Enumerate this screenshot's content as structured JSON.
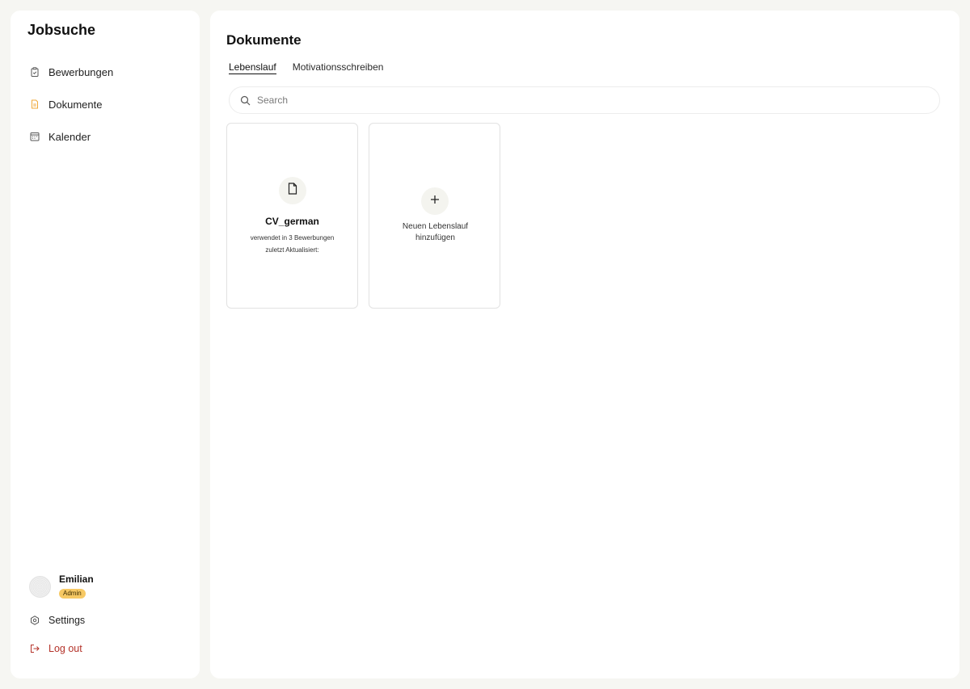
{
  "app": {
    "title": "Jobsuche"
  },
  "sidebar": {
    "items": [
      {
        "label": "Bewerbungen",
        "icon": "clipboard-icon",
        "active": false
      },
      {
        "label": "Dokumente",
        "icon": "document-icon",
        "active": true
      },
      {
        "label": "Kalender",
        "icon": "calendar-icon",
        "active": false
      }
    ],
    "user": {
      "name": "Emilian",
      "role": "Admin"
    },
    "settings_label": "Settings",
    "logout_label": "Log out"
  },
  "main": {
    "title": "Dokumente",
    "tabs": [
      {
        "label": "Lebenslauf",
        "active": true
      },
      {
        "label": "Motivationsschreiben",
        "active": false
      }
    ],
    "search": {
      "placeholder": "Search",
      "value": ""
    },
    "documents": [
      {
        "name": "CV_german",
        "usage": "verwendet in 3 Bewerbungen",
        "updated": "zuletzt Aktualisiert:"
      }
    ],
    "add_card": {
      "label": "Neuen Lebenslauf hinzufügen"
    }
  },
  "colors": {
    "background": "#f6f6f2",
    "panel": "#ffffff",
    "accent": "#f0a93a",
    "badge": "#f7c964",
    "logout": "#b4332a"
  }
}
